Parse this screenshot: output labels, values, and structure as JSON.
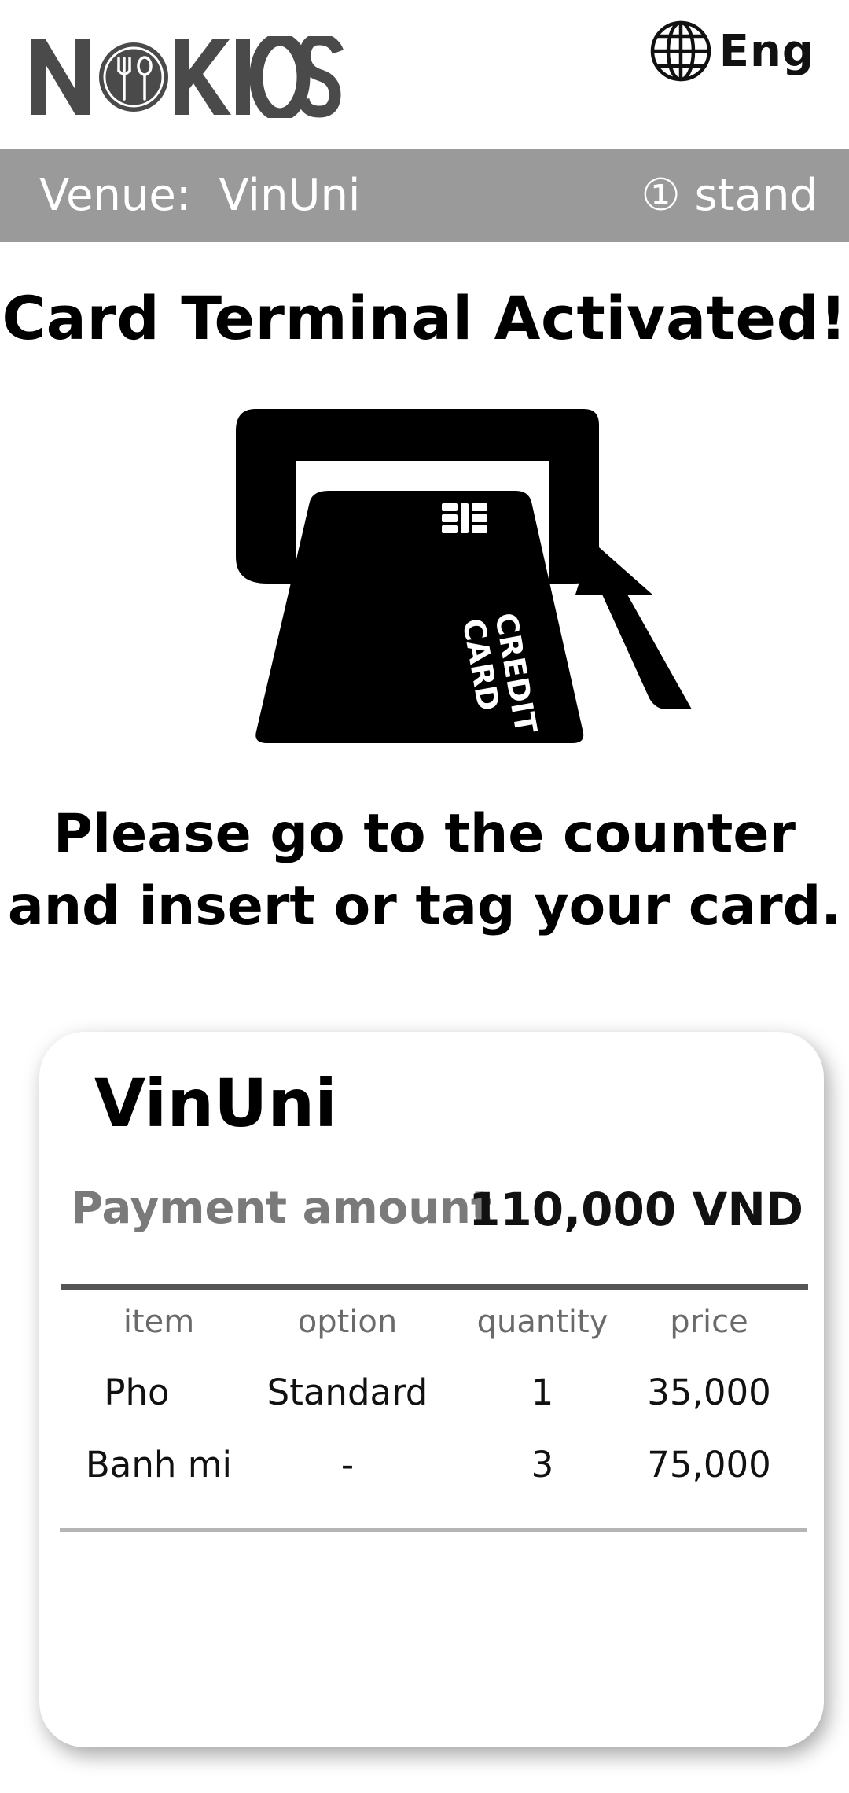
{
  "header": {
    "logo_text": "NOKIOSK",
    "language": "Eng",
    "language_icon": "globe-icon"
  },
  "venue_bar": {
    "venue_label": "Venue:  VinUni",
    "stand_label": "① stand"
  },
  "title": "Card Terminal Activated!",
  "illustration": {
    "card_text_line1": "CREDIT",
    "card_text_line2": "CARD"
  },
  "instruction": {
    "line1": "Please go to the counter",
    "line2": "and insert or tag your card."
  },
  "summary": {
    "venue_name": "VinUni",
    "payment_label": "Payment amount",
    "payment_amount": "110,000 VND",
    "columns": [
      "item",
      "option",
      "quantity",
      "price"
    ],
    "rows": [
      {
        "item": "Pho",
        "option": "Standard",
        "quantity": "1",
        "price": "35,000"
      },
      {
        "item": "Banh mi",
        "option": "-",
        "quantity": "3",
        "price": "75,000"
      }
    ]
  }
}
